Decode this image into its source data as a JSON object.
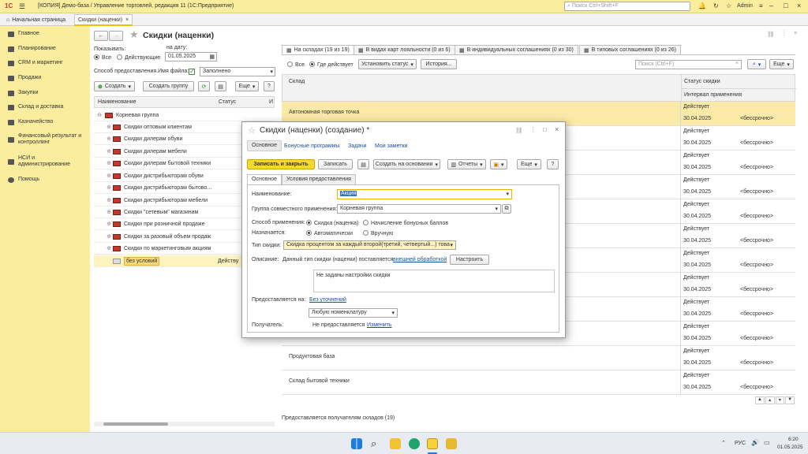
{
  "app": {
    "logo": "1С",
    "title": "[КОПИЯ] Демо-база / Управление торговлей, редакция 11  (1С:Предприятие)",
    "search_placeholder": "Поиск Ctrl+Shift+F",
    "user": "Admin"
  },
  "tabs": {
    "home": "Начальная страница",
    "current": "Скидки (наценки)"
  },
  "sidebar": [
    "Главное",
    "Планирование",
    "CRM и маркетинг",
    "Продажи",
    "Закупки",
    "Склад и доставка",
    "Казначейство",
    "Финансовый результат и контроллинг",
    "НСИ и администрирование",
    "Помощь"
  ],
  "list": {
    "title": "Скидки (наценки)",
    "show_label": "Показывать:",
    "show_all": "Все",
    "show_active": "Действующие",
    "date_label": "на дату:",
    "date": "01.05.2025",
    "method_label": "Способ предоставления.Имя файла:",
    "method_value": "Заполнено",
    "create": "Создать",
    "create_group": "Создать группу",
    "more": "Еще",
    "help": "?",
    "col_name": "Наименование",
    "col_status": "Статус",
    "col_extra": "И",
    "rows": [
      {
        "name": "Корневая группа",
        "status": ""
      },
      {
        "name": "Скидки оптовым клиентам",
        "status": ""
      },
      {
        "name": "Скидки дилерам обуви",
        "status": ""
      },
      {
        "name": "Скидки дилерам мебели",
        "status": ""
      },
      {
        "name": "Скидки дилерам бытовой техники",
        "status": ""
      },
      {
        "name": "Скидки дистрибьюторам обуви",
        "status": ""
      },
      {
        "name": "Скидки дистрибьюторам бытово...",
        "status": ""
      },
      {
        "name": "Скидки дистрибьюторам мебели",
        "status": ""
      },
      {
        "name": "Скидки \"сетевым\" магазинам",
        "status": ""
      },
      {
        "name": "Скидки при розничной продаже",
        "status": ""
      },
      {
        "name": "Скидки за разовый объем продаж",
        "status": ""
      },
      {
        "name": "Скидки по маркетинговым акциям",
        "status": ""
      },
      {
        "name": "без условий",
        "status": "Действу"
      }
    ]
  },
  "right": {
    "tabs": [
      "На складах (19 из 19)",
      "В видах карт лояльности (0 из 6)",
      "В индивидуальных соглашениях (0 из 30)",
      "В типовых соглашениях (0 из 26)"
    ],
    "all": "Все",
    "active": "Где действует",
    "set_status": "Установить статус",
    "history": "История...",
    "search_placeholder": "Поиск (Ctrl+F)",
    "more": "Еще",
    "col_warehouse": "Склад",
    "col_status": "Статус скидки",
    "col_interval": "Интервал применения",
    "rows": [
      {
        "name": "Автономная торговая точка",
        "status": "Действует",
        "date": "30.04.2025",
        "term": "<бессрочно>"
      },
      {
        "name": "",
        "status": "Действует",
        "date": "30.04.2025",
        "term": "<бессрочно>"
      },
      {
        "name": "",
        "status": "Действует",
        "date": "30.04.2025",
        "term": "<бессрочно>"
      },
      {
        "name": "",
        "status": "Действует",
        "date": "30.04.2025",
        "term": "<бессрочно>"
      },
      {
        "name": "",
        "status": "Действует",
        "date": "30.04.2025",
        "term": "<бессрочно>"
      },
      {
        "name": "",
        "status": "Действует",
        "date": "30.04.2025",
        "term": "<бессрочно>"
      },
      {
        "name": "",
        "status": "Действует",
        "date": "30.04.2025",
        "term": "<бессрочно>"
      },
      {
        "name": "",
        "status": "Действует",
        "date": "30.04.2025",
        "term": "<бессрочно>"
      },
      {
        "name": "",
        "status": "Действует",
        "date": "30.04.2025",
        "term": "<бессрочно>"
      },
      {
        "name": "Продуктовая база",
        "status": "Действует",
        "date": "30.04.2025",
        "term": "<бессрочно>"
      },
      {
        "name": "Склад бытовой техники",
        "status": "Действует",
        "date": "30.04.2025",
        "term": "<бессрочно>"
      }
    ],
    "footer": "Предоставляется получателям складов (19)"
  },
  "modal": {
    "title": "Скидки (наценки) (создание) *",
    "nav": [
      "Основное",
      "Бонусные программы",
      "Задачи",
      "Мои заметки"
    ],
    "save_close": "Записать и закрыть",
    "save": "Записать",
    "create_based": "Создать на основании",
    "reports": "Отчеты",
    "more": "Еще",
    "help": "?",
    "tab_main": "Основное",
    "tab_conditions": "Условия предоставления",
    "name_label": "Наименование:",
    "name_value": "Акция",
    "group_label": "Группа совместного применения:",
    "group_value": "Корневая группа",
    "method_label": "Способ применения:",
    "method_discount": "Скидка (наценка)",
    "method_bonus": "Начисление бонусных баллов",
    "assign_label": "Назначается:",
    "assign_auto": "Автоматически",
    "assign_manual": "Вручную",
    "type_label": "Тип скидки:",
    "type_value": "Скидка процентом за каждый второй(третий, четвертый...) товар",
    "desc_label": "Описание:",
    "desc_text": "Данный тип скидки (наценки) поставляется",
    "desc_link": "внешней обработкой",
    "configure": "Настроить",
    "settings_text": "Не заданы настройки скидки",
    "provided_label": "Предоставляется на:",
    "provided_link": "Без уточнений",
    "nomenclature": "Любую номенклатуру",
    "recipient_label": "Получатель:",
    "recipient_text": "Не предоставляется",
    "recipient_link": "Изменить"
  },
  "taskbar": {
    "lang": "РУС",
    "time": "6:20",
    "date": "01.05.2025"
  }
}
